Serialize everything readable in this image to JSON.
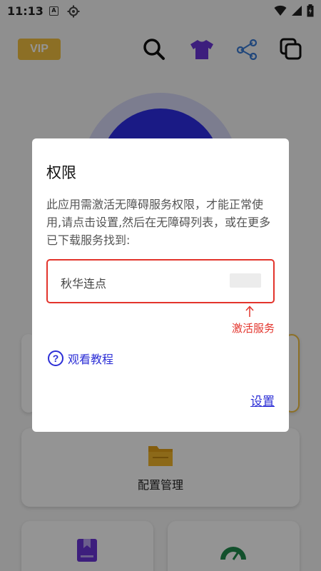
{
  "status_bar": {
    "time": "11:13",
    "notification_letter": "A",
    "icons": [
      "wifi-icon",
      "signal-icon",
      "battery-charging-icon"
    ]
  },
  "toolbar": {
    "vip_label": "VIP",
    "icons": [
      "search-icon",
      "tshirt-icon",
      "share-icon",
      "copy-icon"
    ]
  },
  "cards": {
    "config_label": "配置管理"
  },
  "dialog": {
    "title": "权限",
    "message": "此应用需激活无障碍服务权限，才能正常使用,请点击设置,然后在无障碍列表，或在更多已下载服务找到:",
    "service_name": "秋华连点",
    "hint": "激活服务",
    "tutorial_label": "观看教程",
    "tutorial_icon_glyph": "?",
    "settings_label": "设置"
  },
  "colors": {
    "accent_blue": "#2d2fd6",
    "alert_red": "#e3342c",
    "vip_gold": "#f2c040"
  }
}
